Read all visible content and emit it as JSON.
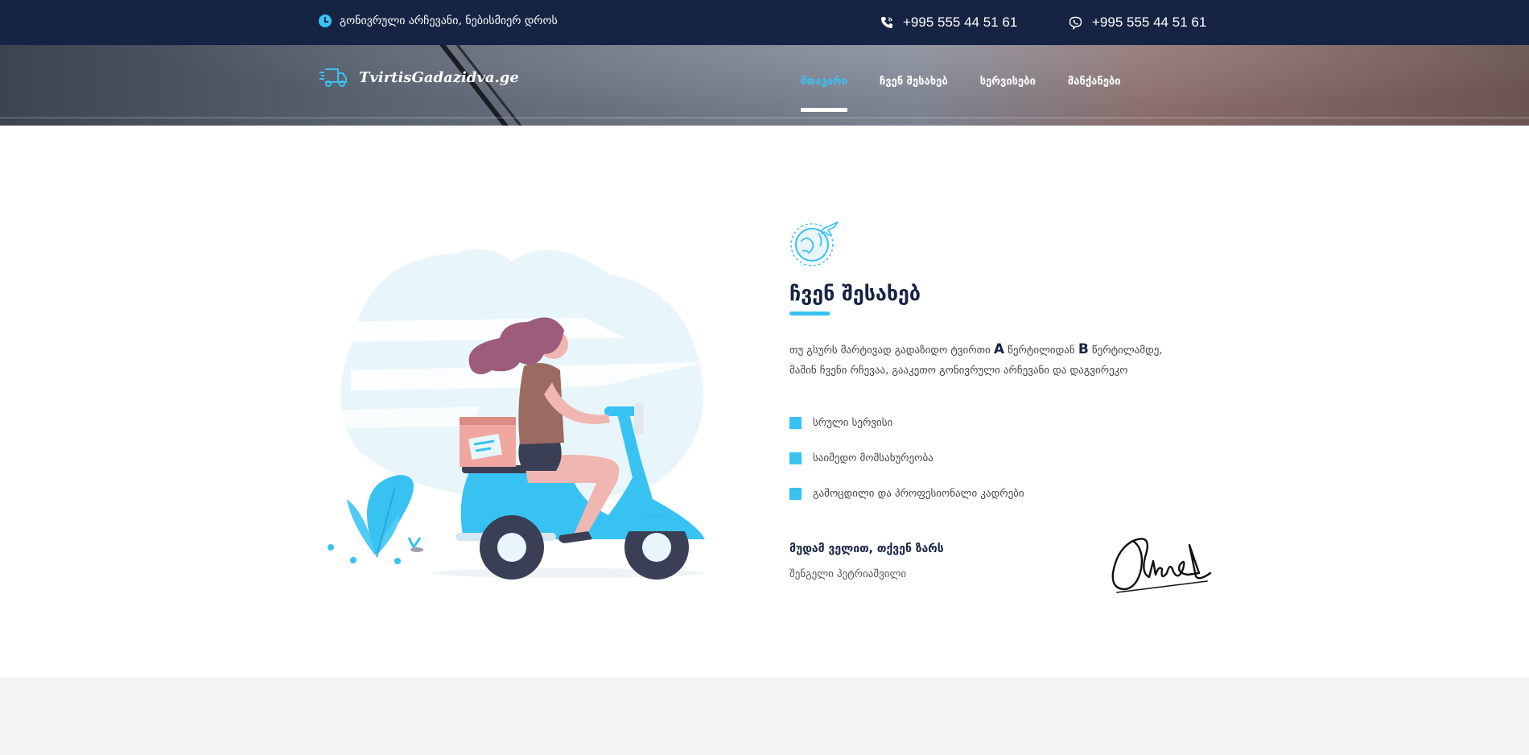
{
  "topbar": {
    "schedule": "გონივრული არჩევანი, ნებისმიერ დროს",
    "phone1": "+995 555 44 51 61",
    "phone2": "+995 555 44 51 61"
  },
  "header": {
    "logo_text": "TvirtisGadazidva.ge",
    "nav": [
      {
        "label": "მთავარი",
        "active": true
      },
      {
        "label": "ჩვენ შესახებ",
        "active": false
      },
      {
        "label": "სერვისები",
        "active": false
      },
      {
        "label": "მანქანები",
        "active": false
      }
    ]
  },
  "about": {
    "title": "ჩვენ შესახებ",
    "text_part1": "თუ გსურს მარტივად გადაზიდო ტვირთი ",
    "text_a": "A",
    "text_part2": " წერტილიდან ",
    "text_b": "B",
    "text_part3": " წერტილამდე, მაშინ ჩვენი რჩევაა, გააკეთო გონივრული არჩევანი და დაგვირეკო",
    "features": [
      "სრული სერვისი",
      "საიმედო მომსახურეობა",
      "გამოცდილი და პროფესიონალი კადრები"
    ],
    "motto": "მუდამ ველით, თქვენ ზარს",
    "signer": "შენგელი პეტრიაშვილი"
  },
  "colors": {
    "topbar": "#162443",
    "accent": "#38c2f2",
    "footer": "#f4f4f4"
  }
}
